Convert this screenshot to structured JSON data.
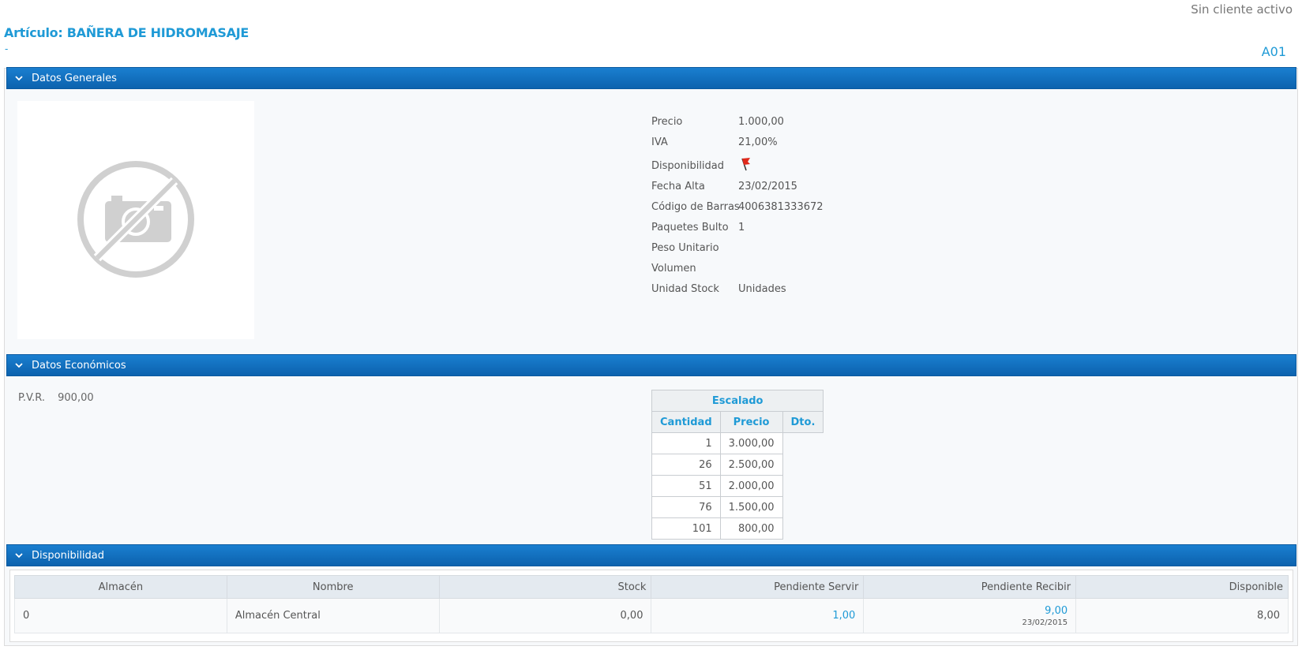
{
  "header": {
    "status": "Sin cliente activo",
    "title": "Artículo: BAÑERA DE HIDROMASAJE",
    "subtitle": "-",
    "code": "A01"
  },
  "sections": {
    "general": "Datos Generales",
    "economic": "Datos Económicos",
    "availability": "Disponibilidad"
  },
  "icons": {
    "chevron": "chevron-down-icon",
    "photo": "no-photo-icon",
    "flag": "flag-icon"
  },
  "colors": {
    "accent": "#1f9ad6",
    "header_bar": "#0c62ae"
  },
  "properties": [
    {
      "label": "Precio",
      "value": "1.000,00"
    },
    {
      "label": "IVA",
      "value": "21,00%"
    },
    {
      "label": "Disponibilidad",
      "value": ""
    },
    {
      "label": "Fecha Alta",
      "value": "23/02/2015"
    },
    {
      "label": "Código de Barras",
      "value": "4006381333672"
    },
    {
      "label": "Paquetes Bulto",
      "value": "1"
    },
    {
      "label": "Peso Unitario",
      "value": ""
    },
    {
      "label": "Volumen",
      "value": ""
    },
    {
      "label": "Unidad Stock",
      "value": "Unidades"
    }
  ],
  "economic": {
    "pvr_label": "P.V.R.",
    "pvr_value": "900,00",
    "escalado": {
      "title": "Escalado",
      "headers": [
        "Cantidad",
        "Precio",
        "Dto."
      ],
      "rows": [
        {
          "cantidad": "1",
          "precio": "3.000,00"
        },
        {
          "cantidad": "26",
          "precio": "2.500,00"
        },
        {
          "cantidad": "51",
          "precio": "2.000,00"
        },
        {
          "cantidad": "76",
          "precio": "1.500,00"
        },
        {
          "cantidad": "101",
          "precio": "800,00"
        }
      ]
    }
  },
  "availability": {
    "headers": [
      "Almacén",
      "Nombre",
      "Stock",
      "Pendiente Servir",
      "Pendiente Recibir",
      "Disponible"
    ],
    "rows": [
      {
        "almacen": "0",
        "nombre": "Almacén Central",
        "stock": "0,00",
        "pendiente_servir": "1,00",
        "pendiente_recibir": "9,00",
        "pendiente_recibir_fecha": "23/02/2015",
        "disponible": "8,00"
      }
    ]
  }
}
